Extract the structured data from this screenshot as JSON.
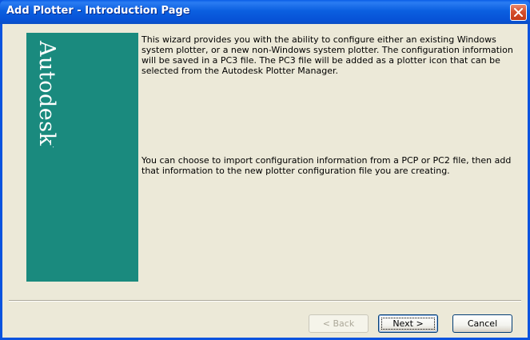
{
  "window": {
    "title": "Add Plotter - Introduction Page"
  },
  "banner": {
    "brand": "Autodesk",
    "trademark": "."
  },
  "content": {
    "paragraph1": "This wizard provides you with the ability to configure either an existing Windows system plotter, or a new non-Windows system plotter. The configuration information will be saved in a PC3 file. The PC3 file will be added as a plotter icon that can be selected from the Autodesk Plotter Manager.",
    "paragraph2": "You can choose to import configuration information from a PCP or PC2 file, then add that information to the new plotter configuration file you are creating."
  },
  "buttons": {
    "back": "< Back",
    "next": "Next >",
    "cancel": "Cancel"
  },
  "colors": {
    "titlebar": "#0a5ee6",
    "banner": "#1a8a7e",
    "dialog_bg": "#ece9d8",
    "close_button": "#d6502e"
  },
  "icons": {
    "close": "close-icon"
  }
}
